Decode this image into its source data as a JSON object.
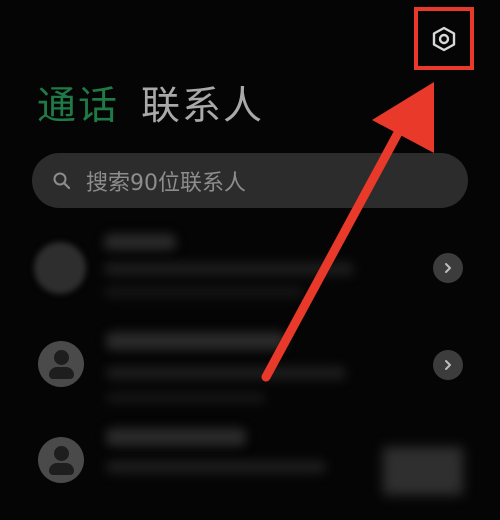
{
  "header": {
    "tabs": [
      {
        "label": "通话",
        "active": true
      },
      {
        "label": "联系人",
        "active": false
      }
    ],
    "settings_icon": "gear-hexagon-icon"
  },
  "search": {
    "placeholder": "搜索90位联系人",
    "icon": "search-icon"
  },
  "contacts": [
    {
      "avatar": "blurred-photo",
      "has_chevron": true
    },
    {
      "avatar": "default-person-icon",
      "has_chevron": true
    },
    {
      "avatar": "default-person-icon",
      "has_chevron": false
    }
  ],
  "annotation": {
    "highlight_color": "#e8392a",
    "target": "settings-button"
  },
  "colors": {
    "background": "#050505",
    "active_tab": "#1f7a45",
    "search_bg": "#2c2c2c"
  }
}
